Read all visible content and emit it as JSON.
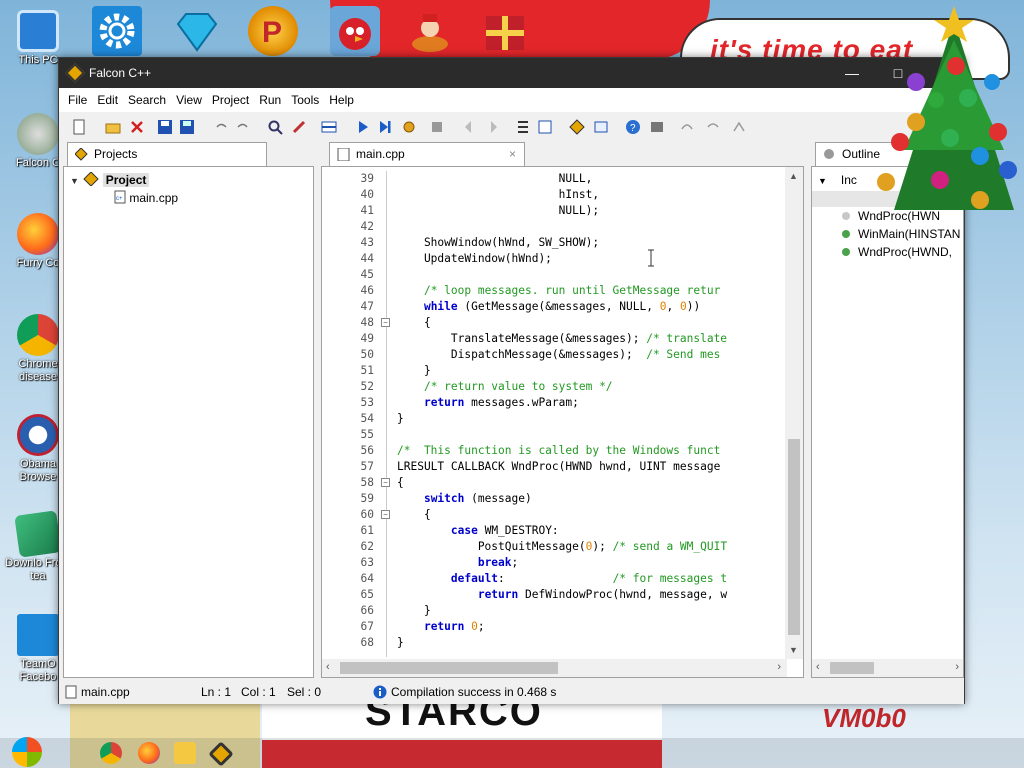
{
  "desktop": {
    "icons": [
      {
        "label": "This PC"
      },
      {
        "label": "Falcon C"
      },
      {
        "label": "Furry Co"
      },
      {
        "label": "Chrome disease"
      },
      {
        "label": "Obama Browse"
      },
      {
        "label": "Downlo From tea"
      },
      {
        "label": "TeamO Facebo"
      }
    ],
    "banner_text": "it's time to eat",
    "poster_text": "STARCO",
    "signature": "VM0b0"
  },
  "window": {
    "title": "Falcon C++",
    "menu": [
      "File",
      "Edit",
      "Search",
      "View",
      "Project",
      "Run",
      "Tools",
      "Help"
    ],
    "left_panel": {
      "tab_label": "Projects",
      "tree": {
        "root": "Project",
        "children": [
          "main.cpp"
        ]
      }
    },
    "editor": {
      "tab_label": "main.cpp",
      "tab_close": "×",
      "lines": [
        {
          "n": "39",
          "t": "                        NULL,"
        },
        {
          "n": "40",
          "t": "                        hInst,"
        },
        {
          "n": "41",
          "t": "                        NULL);"
        },
        {
          "n": "42",
          "t": ""
        },
        {
          "n": "43",
          "t": "    ShowWindow(hWnd, SW_SHOW);"
        },
        {
          "n": "44",
          "t": "    UpdateWindow(hWnd);"
        },
        {
          "n": "45",
          "t": ""
        },
        {
          "n": "46",
          "t": "    /* loop messages. run until GetMessage retur"
        },
        {
          "n": "47",
          "t": "    while (GetMessage(&messages, NULL, 0, 0))"
        },
        {
          "n": "48",
          "t": "    {"
        },
        {
          "n": "49",
          "t": "        TranslateMessage(&messages); /* translate"
        },
        {
          "n": "50",
          "t": "        DispatchMessage(&messages);  /* Send mes"
        },
        {
          "n": "51",
          "t": "    }"
        },
        {
          "n": "52",
          "t": "    /* return value to system */"
        },
        {
          "n": "53",
          "t": "    return messages.wParam;"
        },
        {
          "n": "54",
          "t": "}"
        },
        {
          "n": "55",
          "t": ""
        },
        {
          "n": "56",
          "t": "/*  This function is called by the Windows funct"
        },
        {
          "n": "57",
          "t": "LRESULT CALLBACK WndProc(HWND hwnd, UINT message"
        },
        {
          "n": "58",
          "t": "{"
        },
        {
          "n": "59",
          "t": "    switch (message)"
        },
        {
          "n": "60",
          "t": "    {"
        },
        {
          "n": "61",
          "t": "        case WM_DESTROY:"
        },
        {
          "n": "62",
          "t": "            PostQuitMessage(0); /* send a WM_QUIT"
        },
        {
          "n": "63",
          "t": "            break;"
        },
        {
          "n": "64",
          "t": "        default:                /* for messages t"
        },
        {
          "n": "65",
          "t": "            return DefWindowProc(hwnd, message, w"
        },
        {
          "n": "66",
          "t": "    }"
        },
        {
          "n": "67",
          "t": "    return 0;"
        },
        {
          "n": "68",
          "t": "}"
        }
      ]
    },
    "outline": {
      "tab_label": "Outline",
      "items": [
        {
          "label": "Inc",
          "color": "#cccccc"
        },
        {
          "label": "WndProc(HWN",
          "color": "#c8c8c8"
        },
        {
          "label": "WinMain(HINSTAN",
          "color": "#4aa34a"
        },
        {
          "label": "WndProc(HWND,",
          "color": "#4aa34a"
        }
      ]
    },
    "status": {
      "file": "main.cpp",
      "ln": "Ln : 1",
      "col": "Col : 1",
      "sel": "Sel : 0",
      "message": "Compilation success in 0.468 s"
    }
  }
}
